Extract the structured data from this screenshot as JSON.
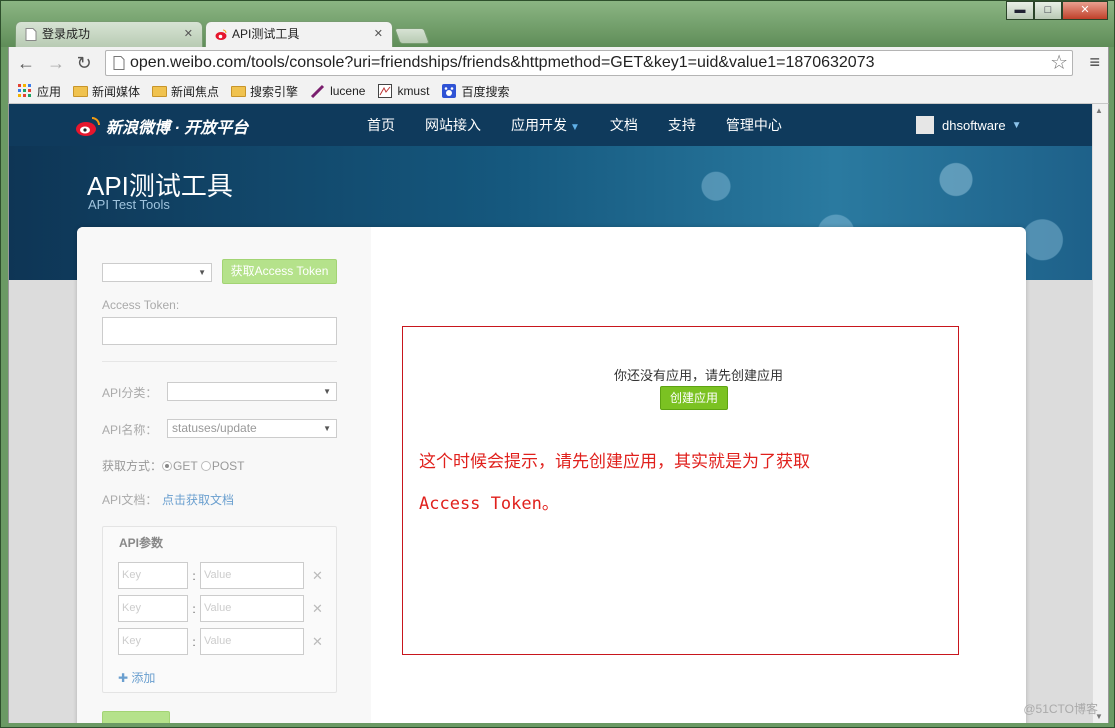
{
  "window": {
    "controls": {
      "minimize": "▬",
      "maximize": "□",
      "close": "✕"
    }
  },
  "tabs": [
    {
      "title": "登录成功",
      "active": false
    },
    {
      "title": "API测试工具",
      "active": true
    }
  ],
  "toolbar": {
    "back": "←",
    "forward": "→",
    "reload": "↻",
    "url": "open.weibo.com/tools/console?uri=friendships/friends&httpmethod=GET&key1=uid&value1=1870632073",
    "star": "☆",
    "menu": "≡"
  },
  "bookmarks": [
    {
      "label": "应用",
      "icon": "apps-grid-icon"
    },
    {
      "label": "新闻媒体",
      "icon": "folder-icon"
    },
    {
      "label": "新闻焦点",
      "icon": "folder-icon"
    },
    {
      "label": "搜索引擎",
      "icon": "folder-icon"
    },
    {
      "label": "lucene",
      "icon": "feather-icon"
    },
    {
      "label": "kmust",
      "icon": "kmust-icon"
    },
    {
      "label": "百度搜索",
      "icon": "baidu-paw-icon"
    }
  ],
  "site": {
    "logo_text": "新浪微博 · 开放平台",
    "nav": [
      "首页",
      "网站接入",
      "应用开发",
      "文档",
      "支持",
      "管理中心"
    ],
    "username": "dhsoftware"
  },
  "page": {
    "title": "API测试工具",
    "subtitle": "API Test Tools"
  },
  "form": {
    "get_token_button": "获取Access Token",
    "access_token_label": "Access Token:",
    "api_category_label": "API分类：",
    "api_name_label": "API名称：",
    "api_name_value": "statuses/update",
    "method_label": "获取方式：",
    "method_get": "GET",
    "method_post": "POST",
    "method_selected": "GET",
    "api_doc_label": "API文档：",
    "api_doc_link": "点击获取文档",
    "params_title": "API参数",
    "key_placeholder": "Key",
    "value_placeholder": "Value",
    "remove_icon": "✕",
    "add_label": "添加"
  },
  "result": {
    "notice": "你还没有应用，请先创建应用",
    "create_button": "创建应用"
  },
  "annotation": {
    "line1": "这个时候会提示，请先创建应用，其实就是为了获取",
    "line2": "Access Token。"
  },
  "watermark": "@51CTO博客"
}
